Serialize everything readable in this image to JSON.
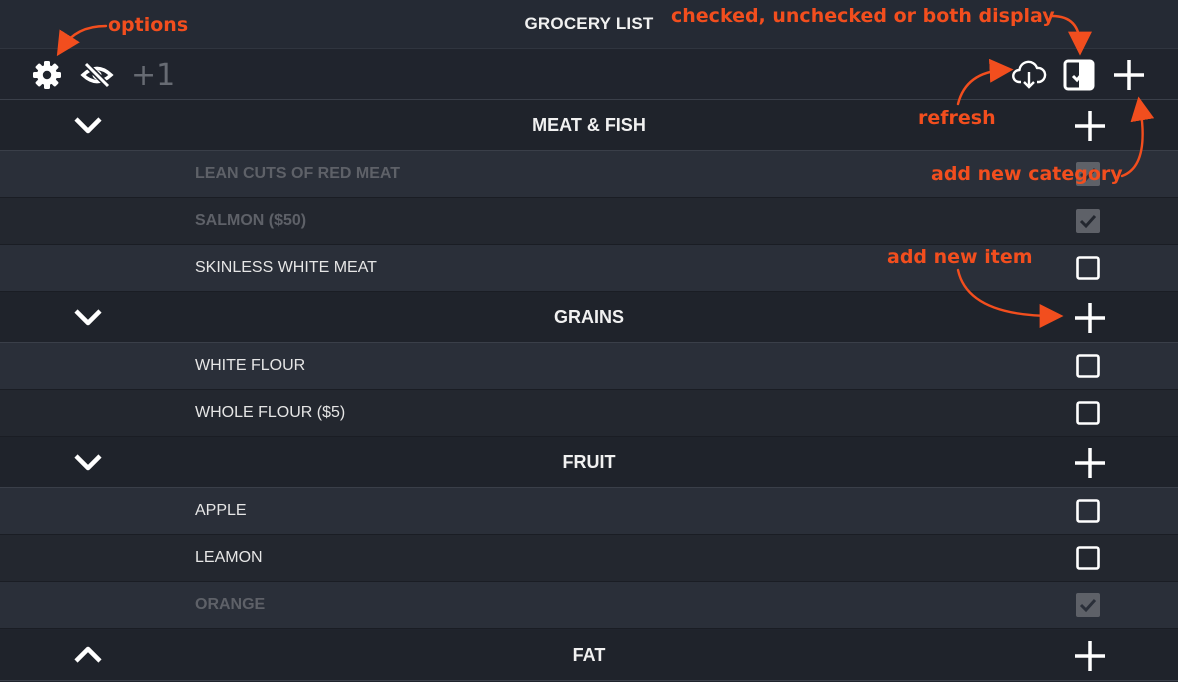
{
  "header": {
    "title": "GROCERY LIST"
  },
  "toolbar": {
    "counter": "+1",
    "left_icons": [
      "gear-icon",
      "eye-slash-icon"
    ],
    "right_icons": [
      "cloud-download-icon",
      "checked-toggle-icon",
      "plus-icon"
    ]
  },
  "categories": [
    {
      "name": "MEAT & FISH",
      "expanded": true,
      "items": [
        {
          "label": "LEAN CUTS OF RED MEAT",
          "checked": true
        },
        {
          "label": "SALMON ($50)",
          "checked": true
        },
        {
          "label": "SKINLESS WHITE MEAT",
          "checked": false
        }
      ]
    },
    {
      "name": "GRAINS",
      "expanded": true,
      "items": [
        {
          "label": "WHITE FLOUR",
          "checked": false
        },
        {
          "label": "WHOLE FLOUR ($5)",
          "checked": false
        }
      ]
    },
    {
      "name": "FRUIT",
      "expanded": true,
      "items": [
        {
          "label": "APPLE",
          "checked": false
        },
        {
          "label": "LEAMON",
          "checked": false
        },
        {
          "label": "ORANGE",
          "checked": true
        }
      ]
    },
    {
      "name": "FAT",
      "expanded": false,
      "items": []
    }
  ],
  "annotations": {
    "options": "options",
    "display": "checked, unchecked or both display",
    "refresh": "refresh",
    "add_category": "add new category",
    "add_item": "add new item"
  },
  "colors": {
    "annotation": "#f24e1e",
    "background": "#20242d",
    "row_light": "#2a2f39",
    "row_dark": "#23272f",
    "checked_text": "#5e6168"
  }
}
